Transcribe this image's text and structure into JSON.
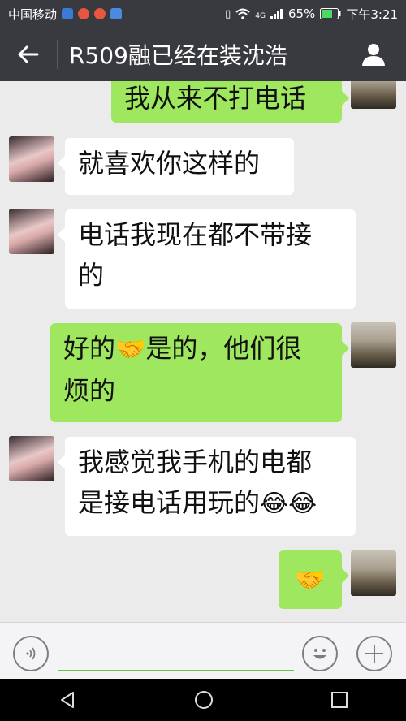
{
  "status_bar": {
    "carrier": "中国移动",
    "signal_label": "4G",
    "battery": "65%",
    "time": "下午3:21"
  },
  "header": {
    "title": "R509融已经在装沈浩",
    "back_icon": "back-arrow-icon",
    "profile_icon": "person-icon"
  },
  "messages": [
    {
      "side": "sent",
      "text": "我从来不打电话"
    },
    {
      "side": "received",
      "text": "就喜欢你这样的"
    },
    {
      "side": "received",
      "line1": "电话我现在都不带接",
      "line2": "的"
    },
    {
      "side": "sent",
      "line1a": "好的",
      "line1_emoji": "🤝",
      "line1b": "是的，他们很",
      "line2": "烦的"
    },
    {
      "side": "received",
      "line1": "我感觉我手机的电都",
      "line2": "是接电话用玩的",
      "line2_emoji": "😂😂"
    },
    {
      "side": "sent",
      "emoji": "🤝"
    }
  ],
  "input_bar": {
    "voice_icon": "voice-icon",
    "emoji_icon": "smiley-icon",
    "add_icon": "plus-icon",
    "value": ""
  },
  "colors": {
    "bar": "#393a3f",
    "sent_bubble": "#9fe75e",
    "received_bubble": "#ffffff",
    "chat_bg": "#ebebeb"
  }
}
